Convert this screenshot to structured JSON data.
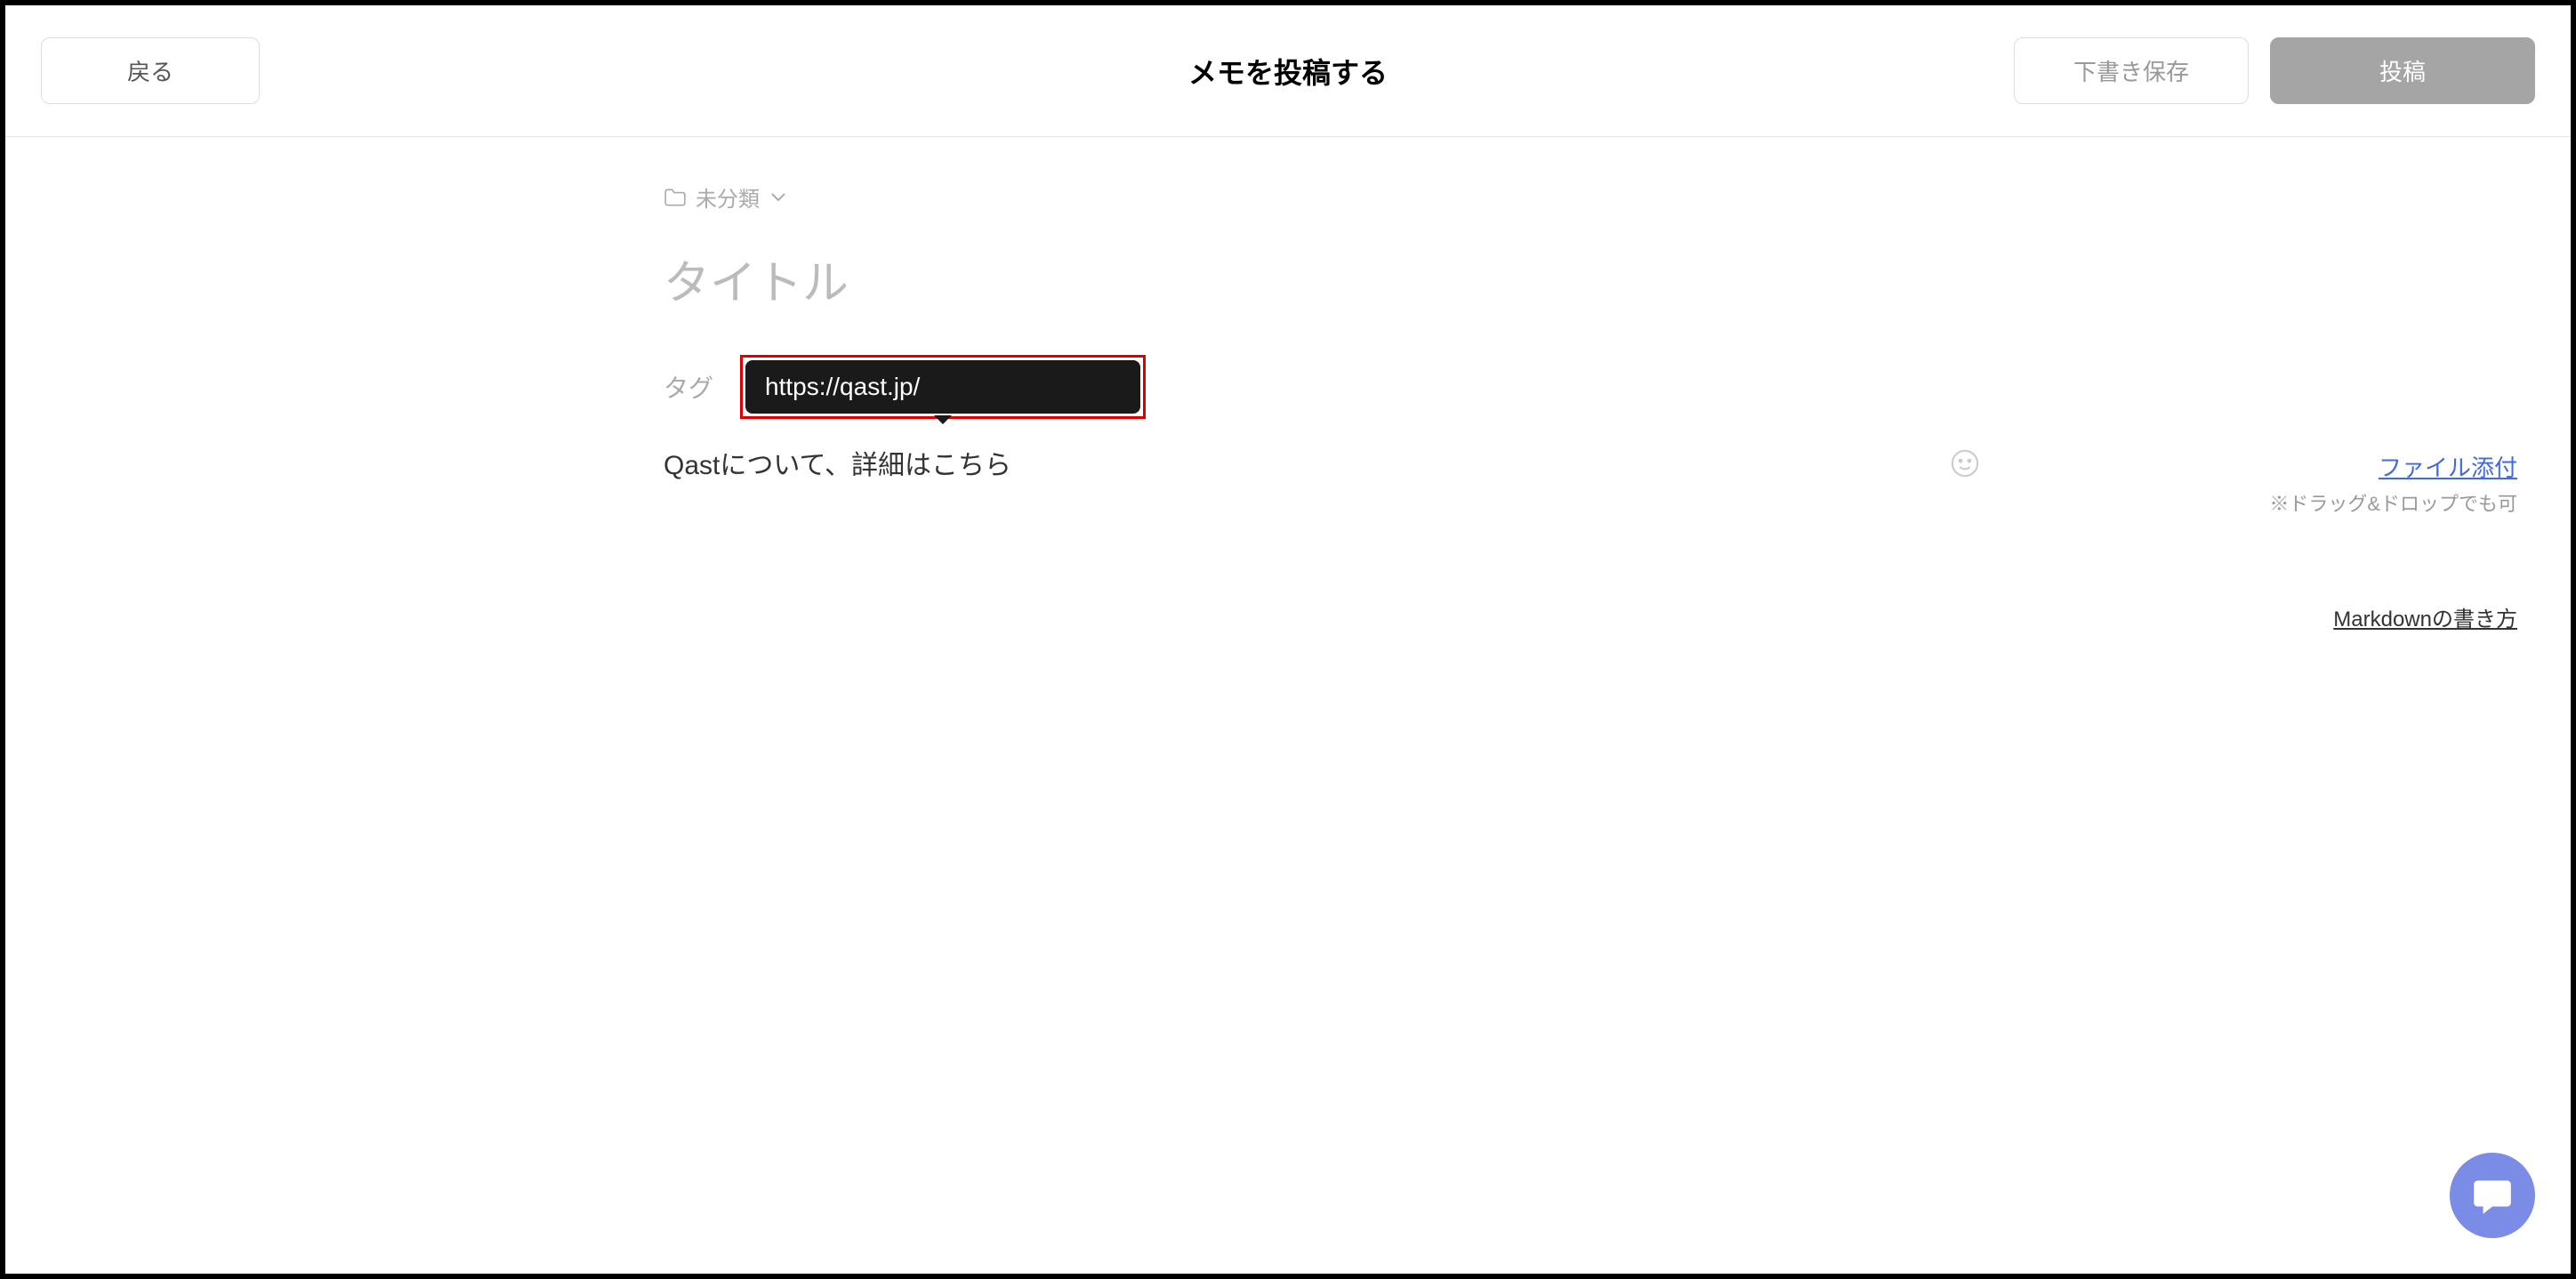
{
  "header": {
    "back_label": "戻る",
    "title": "メモを投稿する",
    "draft_label": "下書き保存",
    "post_label": "投稿"
  },
  "folder": {
    "label": "未分類"
  },
  "title_placeholder": "タイトル",
  "tag_label": "タグ",
  "url_input_value": "https://qast.jp/",
  "editor_text": "Qastについて、詳細はこちら",
  "file_attach_label": "ファイル添付",
  "drag_drop_hint": "※ドラッグ&ドロップでも可",
  "markdown_help_label": "Markdownの書き方"
}
